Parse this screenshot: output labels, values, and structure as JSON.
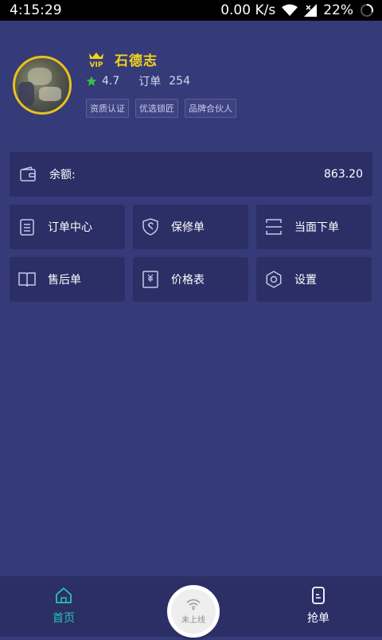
{
  "status_bar": {
    "time": "4:15:29",
    "speed": "0.00 K/s",
    "battery": "22%"
  },
  "profile": {
    "name": "石德志",
    "rating": "4.7",
    "orders_label": "订单",
    "orders_count": "254",
    "tags": [
      "资质认证",
      "优选锁匠",
      "品牌合伙人"
    ]
  },
  "balance": {
    "label": "余额:",
    "value": "863.20"
  },
  "menu": [
    {
      "label": "订单中心",
      "icon": "clipboard-icon"
    },
    {
      "label": "保修单",
      "icon": "shield-wrench-icon"
    },
    {
      "label": "当面下单",
      "icon": "scan-icon"
    },
    {
      "label": "售后单",
      "icon": "book-icon"
    },
    {
      "label": "价格表",
      "icon": "price-tag-icon"
    },
    {
      "label": "设置",
      "icon": "gear-icon"
    }
  ],
  "bottom_nav": {
    "home": "首页",
    "center": "未上线",
    "grab": "抢单"
  },
  "colors": {
    "background": "#353a78",
    "card": "#2b2f66",
    "accent_teal": "#27c3b1",
    "name_yellow": "#f2d21e",
    "star_green": "#3dbd4a"
  }
}
